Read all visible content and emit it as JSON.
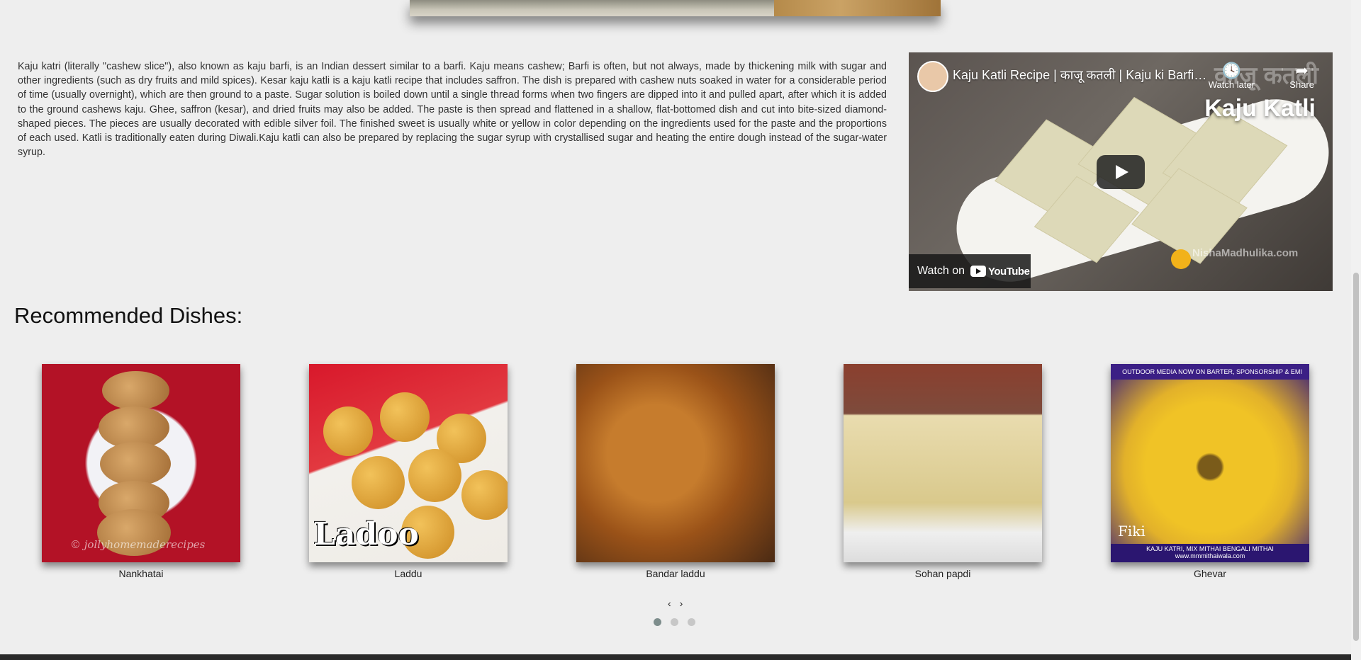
{
  "description": "Kaju katri (literally \"cashew slice\"), also known as kaju barfi, is an Indian dessert similar to a barfi. Kaju means cashew; Barfi is often, but not always, made by thickening milk with sugar and other ingredients (such as dry fruits and mild spices). Kesar kaju katli is a kaju katli recipe that includes saffron. The dish is prepared with cashew nuts soaked in water for a considerable period of time (usually overnight), which are then ground to a paste. Sugar solution is boiled down until a single thread forms when two fingers are dipped into it and pulled apart, after which it is added to the ground cashews kaju. Ghee, saffron (kesar), and dried fruits may also be added. The paste is then spread and flattened in a shallow, flat-bottomed dish and cut into bite-sized diamond-shaped pieces. The pieces are usually decorated with edible silver foil. The finished sweet is usually white or yellow in color depending on the ingredients used for the paste and the proportions of each used. Katli is traditionally eaten during Diwali.Kaju katli can also be prepared by replacing the sugar syrup with crystallised sugar and heating the entire dough instead of the sugar-water syrup.",
  "video": {
    "title": "Kaju Katli Recipe | काजू कतली | Kaju ki Barfi R...",
    "watch_later": "Watch later",
    "share": "Share",
    "overlay_title": "Kaju Katli",
    "overlay_hindi": "काजू कतली",
    "watch_on": "Watch on",
    "youtube": "YouTube",
    "watermark": "NishaMadhulika.com"
  },
  "recommended": {
    "heading": "Recommended Dishes:",
    "dishes": [
      {
        "name": "Nankhatai",
        "watermark": "© jollyhomemaderecipes"
      },
      {
        "name": "Laddu",
        "image_text": "Ladoo"
      },
      {
        "name": "Bandar laddu"
      },
      {
        "name": "Sohan papdi"
      },
      {
        "name": "Ghevar",
        "image_text": "Fiki",
        "banner_top": "OUTDOOR MEDIA NOW ON BARTER, SPONSORSHIP & EMI",
        "banner_bottom": "KAJU KATRI, MIX MITHAI  BENGALI MITHAI    www.mmmithaiwala.com"
      }
    ],
    "prev": "‹",
    "next": "›",
    "pages": 3,
    "active_page": 1
  },
  "colors": {
    "background": "#eeeeee",
    "dot_active": "#7d8d8c",
    "dot_inactive": "#c7c7c7",
    "footer": "#2a2a2a"
  }
}
